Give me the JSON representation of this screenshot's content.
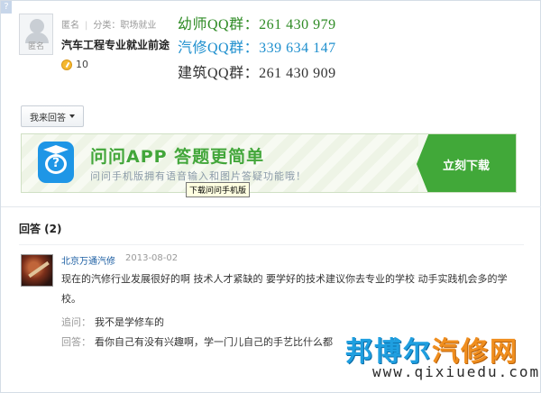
{
  "question": {
    "corner": "?",
    "avatar_label": "匿名",
    "author": "匿名",
    "category": "分类：职场就业",
    "title": "汽车工程专业就业前途",
    "score": "10"
  },
  "qq_groups": [
    "幼师QQ群：261 430 979",
    "汽修QQ群：339 634 147",
    "建筑QQ群：261 430 909"
  ],
  "my_answer_button": "我来回答",
  "banner": {
    "title": "问问APP 答题更简单",
    "subtitle": "问问手机版拥有语音输入和图片答疑功能哦！",
    "download_label": "立刻下载",
    "tooltip": "下载问问手机版"
  },
  "answers": {
    "header": "回答 (2)",
    "items": [
      {
        "user": "北京万通汽修",
        "date": "2013-08-02",
        "text": "现在的汽修行业发展很好的啊 技术人才紧缺的 要学好的技术建议你去专业的学校 动手实践机会多的学校。",
        "follow_tag": "追问：",
        "follow_text": "我不是学修车的",
        "reply_tag": "回答：",
        "reply_text": "看你自己有没有兴趣啊，学一门儿自己的手艺比什么都"
      }
    ]
  },
  "watermark": {
    "brand_part1": "邦博尔",
    "brand_part2": "汽修网",
    "url": "www.qixiuedu.com"
  },
  "colors": {
    "accent_green": "#42a63a",
    "link_blue": "#1d5fa3",
    "qq_green": "#2e8b24",
    "qq_blue": "#1e8fce"
  }
}
